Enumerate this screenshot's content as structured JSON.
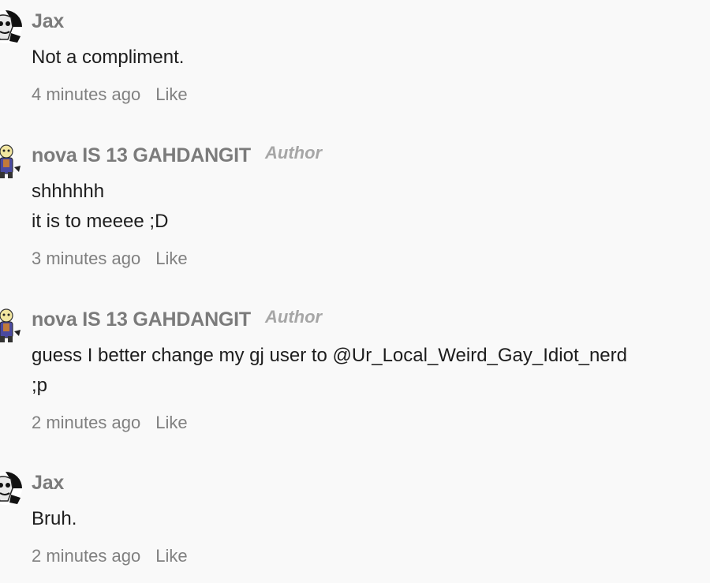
{
  "comments": [
    {
      "username": "Jax",
      "author_badge": "",
      "avatar_icon": "jax-avatar-icon",
      "lines": [
        "Not a compliment."
      ],
      "time": "4 minutes ago",
      "like_label": "Like"
    },
    {
      "username": "nova IS 13 GAHDANGIT",
      "author_badge": "Author",
      "avatar_icon": "nova-avatar-icon",
      "lines": [
        "shhhhhh",
        "it is to meeee ;D"
      ],
      "time": "3 minutes ago",
      "like_label": "Like"
    },
    {
      "username": "nova IS 13 GAHDANGIT",
      "author_badge": "Author",
      "avatar_icon": "nova-avatar-icon",
      "lines": [
        "guess I better change my gj user to @Ur_Local_Weird_Gay_Idiot_nerd",
        ";p"
      ],
      "time": "2 minutes ago",
      "like_label": "Like"
    },
    {
      "username": "Jax",
      "author_badge": "",
      "avatar_icon": "jax-avatar-icon",
      "lines": [
        "Bruh."
      ],
      "time": "2 minutes ago",
      "like_label": "Like"
    }
  ]
}
